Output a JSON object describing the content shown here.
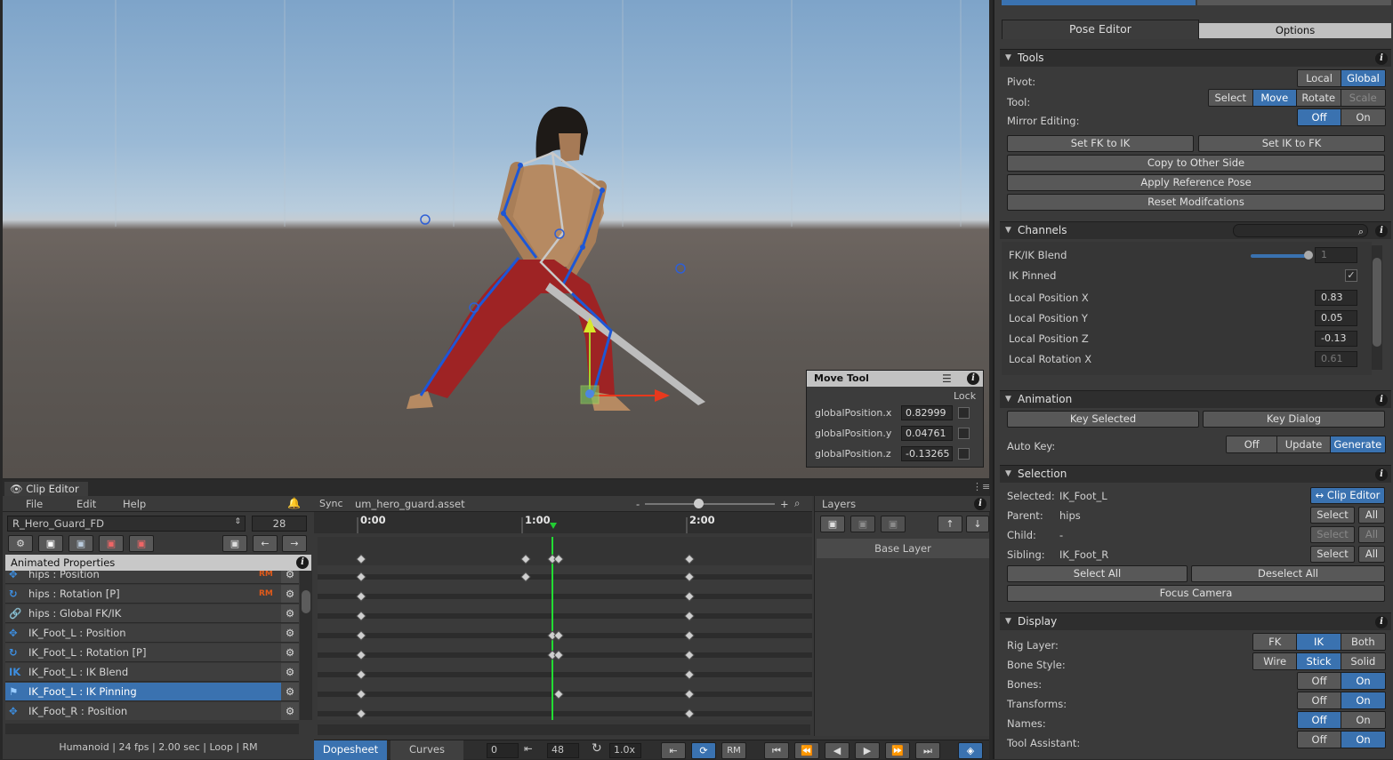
{
  "move_tool": {
    "title": "Move Tool",
    "lock_label": "Lock",
    "fields": [
      {
        "label": "globalPosition.x",
        "value": "0.82999"
      },
      {
        "label": "globalPosition.y",
        "value": "0.04761"
      },
      {
        "label": "globalPosition.z",
        "value": "-0.13265"
      }
    ]
  },
  "clip_editor": {
    "tab_label": "Clip Editor",
    "menu": [
      "File",
      "Edit",
      "Help"
    ],
    "clip_name": "R_Hero_Guard_FD",
    "frame_value": "28",
    "sync_label": "Sync",
    "asset_name": "um_hero_guard.asset",
    "zoom_minus": "-",
    "zoom_plus": "+",
    "animated_properties_label": "Animated Properties",
    "properties": [
      {
        "icon": "move",
        "label": "hips : Position",
        "rm": "RM",
        "selected": false
      },
      {
        "icon": "rotate",
        "label": "hips : Rotation [P]",
        "rm": "RM",
        "selected": false
      },
      {
        "icon": "link",
        "label": "hips : Global FK/IK",
        "rm": "",
        "selected": false
      },
      {
        "icon": "move",
        "label": "IK_Foot_L : Position",
        "rm": "",
        "selected": false
      },
      {
        "icon": "rotate",
        "label": "IK_Foot_L : Rotation [P]",
        "rm": "",
        "selected": false
      },
      {
        "icon": "ik",
        "label": "IK_Foot_L : IK Blend",
        "rm": "",
        "selected": false
      },
      {
        "icon": "pin",
        "label": "IK_Foot_L : IK Pinning",
        "rm": "",
        "selected": true
      },
      {
        "icon": "move",
        "label": "IK_Foot_R : Position",
        "rm": "",
        "selected": false
      }
    ],
    "status": "Humanoid | 24 fps | 2.00 sec | Loop | RM",
    "time_labels": [
      "0:00",
      "1:00",
      "2:00"
    ],
    "layers_label": "Layers",
    "base_layer": "Base Layer",
    "bottom_tabs": [
      "Dopesheet",
      "Curves"
    ],
    "start_frame": "0",
    "end_frame": "48",
    "speed": "1.0x",
    "rm_label": "RM"
  },
  "pose_editor": {
    "tabs": [
      "Pose Editor",
      "Options"
    ],
    "tools": {
      "title": "Tools",
      "pivot_label": "Pivot:",
      "pivot_options": [
        "Local",
        "Global"
      ],
      "tool_label": "Tool:",
      "tool_options": [
        "Select",
        "Move",
        "Rotate",
        "Scale"
      ],
      "mirror_label": "Mirror Editing:",
      "mirror_options": [
        "Off",
        "On"
      ],
      "set_fk_to_ik": "Set FK to IK",
      "set_ik_to_fk": "Set IK to FK",
      "copy_other_side": "Copy to Other Side",
      "apply_reference": "Apply Reference Pose",
      "reset_mods": "Reset Modifcations"
    },
    "channels": {
      "title": "Channels",
      "rows": [
        {
          "name": "FK/IK Blend",
          "value": "1"
        },
        {
          "name": "IK Pinned",
          "value": ""
        },
        {
          "name": "Local Position X",
          "value": "0.83"
        },
        {
          "name": "Local Position Y",
          "value": "0.05"
        },
        {
          "name": "Local Position Z",
          "value": "-0.13"
        },
        {
          "name": "Local Rotation X",
          "value": "0.61"
        }
      ]
    },
    "animation": {
      "title": "Animation",
      "key_selected": "Key Selected",
      "key_dialog": "Key Dialog",
      "auto_key_label": "Auto Key:",
      "auto_key_options": [
        "Off",
        "Update",
        "Generate"
      ]
    },
    "selection": {
      "title": "Selection",
      "selected_label": "Selected:",
      "selected_value": "IK_Foot_L",
      "clip_editor_btn": "↔ Clip Editor",
      "parent_label": "Parent:",
      "parent_value": "hips",
      "child_label": "Child:",
      "child_value": "-",
      "sibling_label": "Sibling:",
      "sibling_value": "IK_Foot_R",
      "select": "Select",
      "all": "All",
      "select_all": "Select All",
      "deselect_all": "Deselect All",
      "focus_camera": "Focus Camera"
    },
    "display": {
      "title": "Display",
      "rig_layer_label": "Rig Layer:",
      "rig_layer_options": [
        "FK",
        "IK",
        "Both"
      ],
      "bone_style_label": "Bone Style:",
      "bone_style_options": [
        "Wire",
        "Stick",
        "Solid"
      ],
      "bones_label": "Bones:",
      "transforms_label": "Transforms:",
      "names_label": "Names:",
      "tool_assistant_label": "Tool Assistant:",
      "off": "Off",
      "on": "On"
    }
  }
}
